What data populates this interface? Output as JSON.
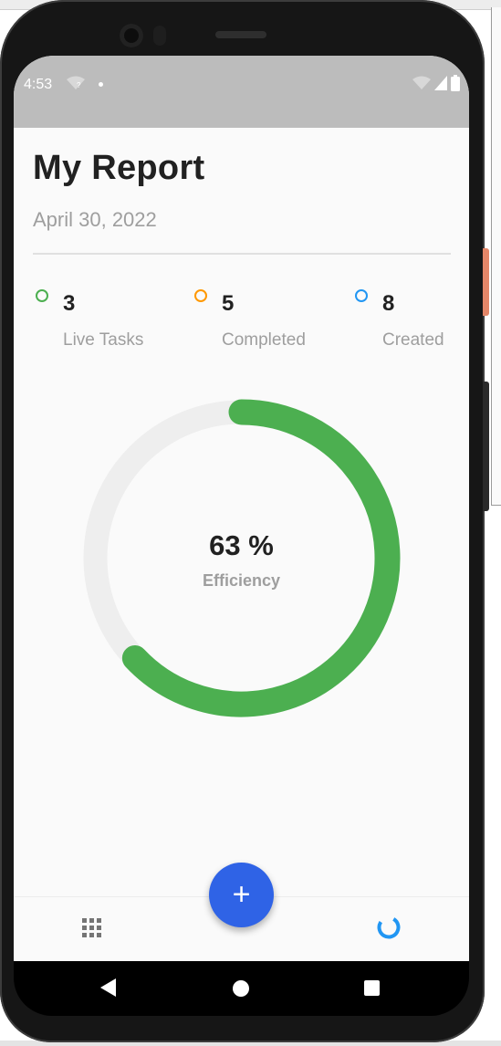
{
  "status_bar": {
    "time": "4:53",
    "icons": [
      "wifi-question-icon",
      "notification-dot-icon",
      "wifi-icon",
      "signal-icon",
      "battery-icon"
    ]
  },
  "report": {
    "title": "My Report",
    "date": "April 30, 2022"
  },
  "stats": [
    {
      "value": "3",
      "label": "Live Tasks",
      "color": "#4caf50"
    },
    {
      "value": "5",
      "label": "Completed",
      "color": "#ff9800"
    },
    {
      "value": "8",
      "label": "Created",
      "color": "#2196f3"
    }
  ],
  "efficiency": {
    "percent_text": "63 %",
    "label": "Efficiency",
    "value": 0.63,
    "color": "#4caf50",
    "track_color": "#eeeeee"
  },
  "fab": {
    "label": "+",
    "color": "#2f63e6"
  },
  "bottom_nav": {
    "items": [
      "grid-icon",
      "report-ring-icon"
    ],
    "active_color": "#2196f3"
  },
  "system_nav": [
    "back-icon",
    "home-icon",
    "recents-icon"
  ]
}
